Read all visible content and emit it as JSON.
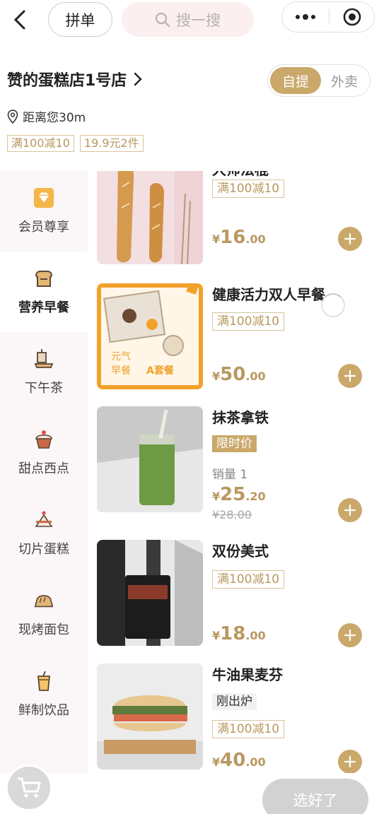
{
  "topbar": {
    "group_label": "拼单",
    "search_placeholder": "搜一搜"
  },
  "store": {
    "name": "赞的蛋糕店1号店",
    "mode_active": "自提",
    "mode_inactive": "外卖",
    "distance": "距离您30m",
    "promos": [
      "满100减10",
      "19.9元2件"
    ]
  },
  "sidebar": {
    "items": [
      {
        "label": "会员尊享",
        "icon": "diamond-icon"
      },
      {
        "label": "营养早餐",
        "icon": "toast-icon",
        "active": true
      },
      {
        "label": "下午茶",
        "icon": "tea-icon"
      },
      {
        "label": "甜点西点",
        "icon": "cupcake-icon"
      },
      {
        "label": "切片蛋糕",
        "icon": "cake-slice-icon"
      },
      {
        "label": "现烤面包",
        "icon": "bread-icon"
      },
      {
        "label": "鲜制饮品",
        "icon": "drink-icon"
      }
    ]
  },
  "products": [
    {
      "title": "大师法棍",
      "tag": "满100减10",
      "price_int": "16",
      "price_dec": ".00"
    },
    {
      "title": "健康活力双人早餐",
      "tag": "满100减10",
      "price_int": "50",
      "price_dec": ".00",
      "image_text_1": "元气",
      "image_text_2": "早餐",
      "image_text_3": "A套餐"
    },
    {
      "title": "抹茶拿铁",
      "tag": "限时价",
      "sales": "销量 1",
      "price_int": "25",
      "price_dec": ".20",
      "old_price": "¥28.00"
    },
    {
      "title": "双份美式",
      "tag": "满100减10",
      "price_int": "18",
      "price_dec": ".00"
    },
    {
      "title": "牛油果麦芬",
      "tag_gray": "刚出炉",
      "tag": "满100减10",
      "price_int": "40",
      "price_dec": ".00"
    }
  ],
  "currency": "¥",
  "bottombar": {
    "done_label": "选好了"
  },
  "colors": {
    "accent": "#c9a86a",
    "sidebar_bg": "#fbf6f7",
    "search_bg": "#fbeff0"
  }
}
